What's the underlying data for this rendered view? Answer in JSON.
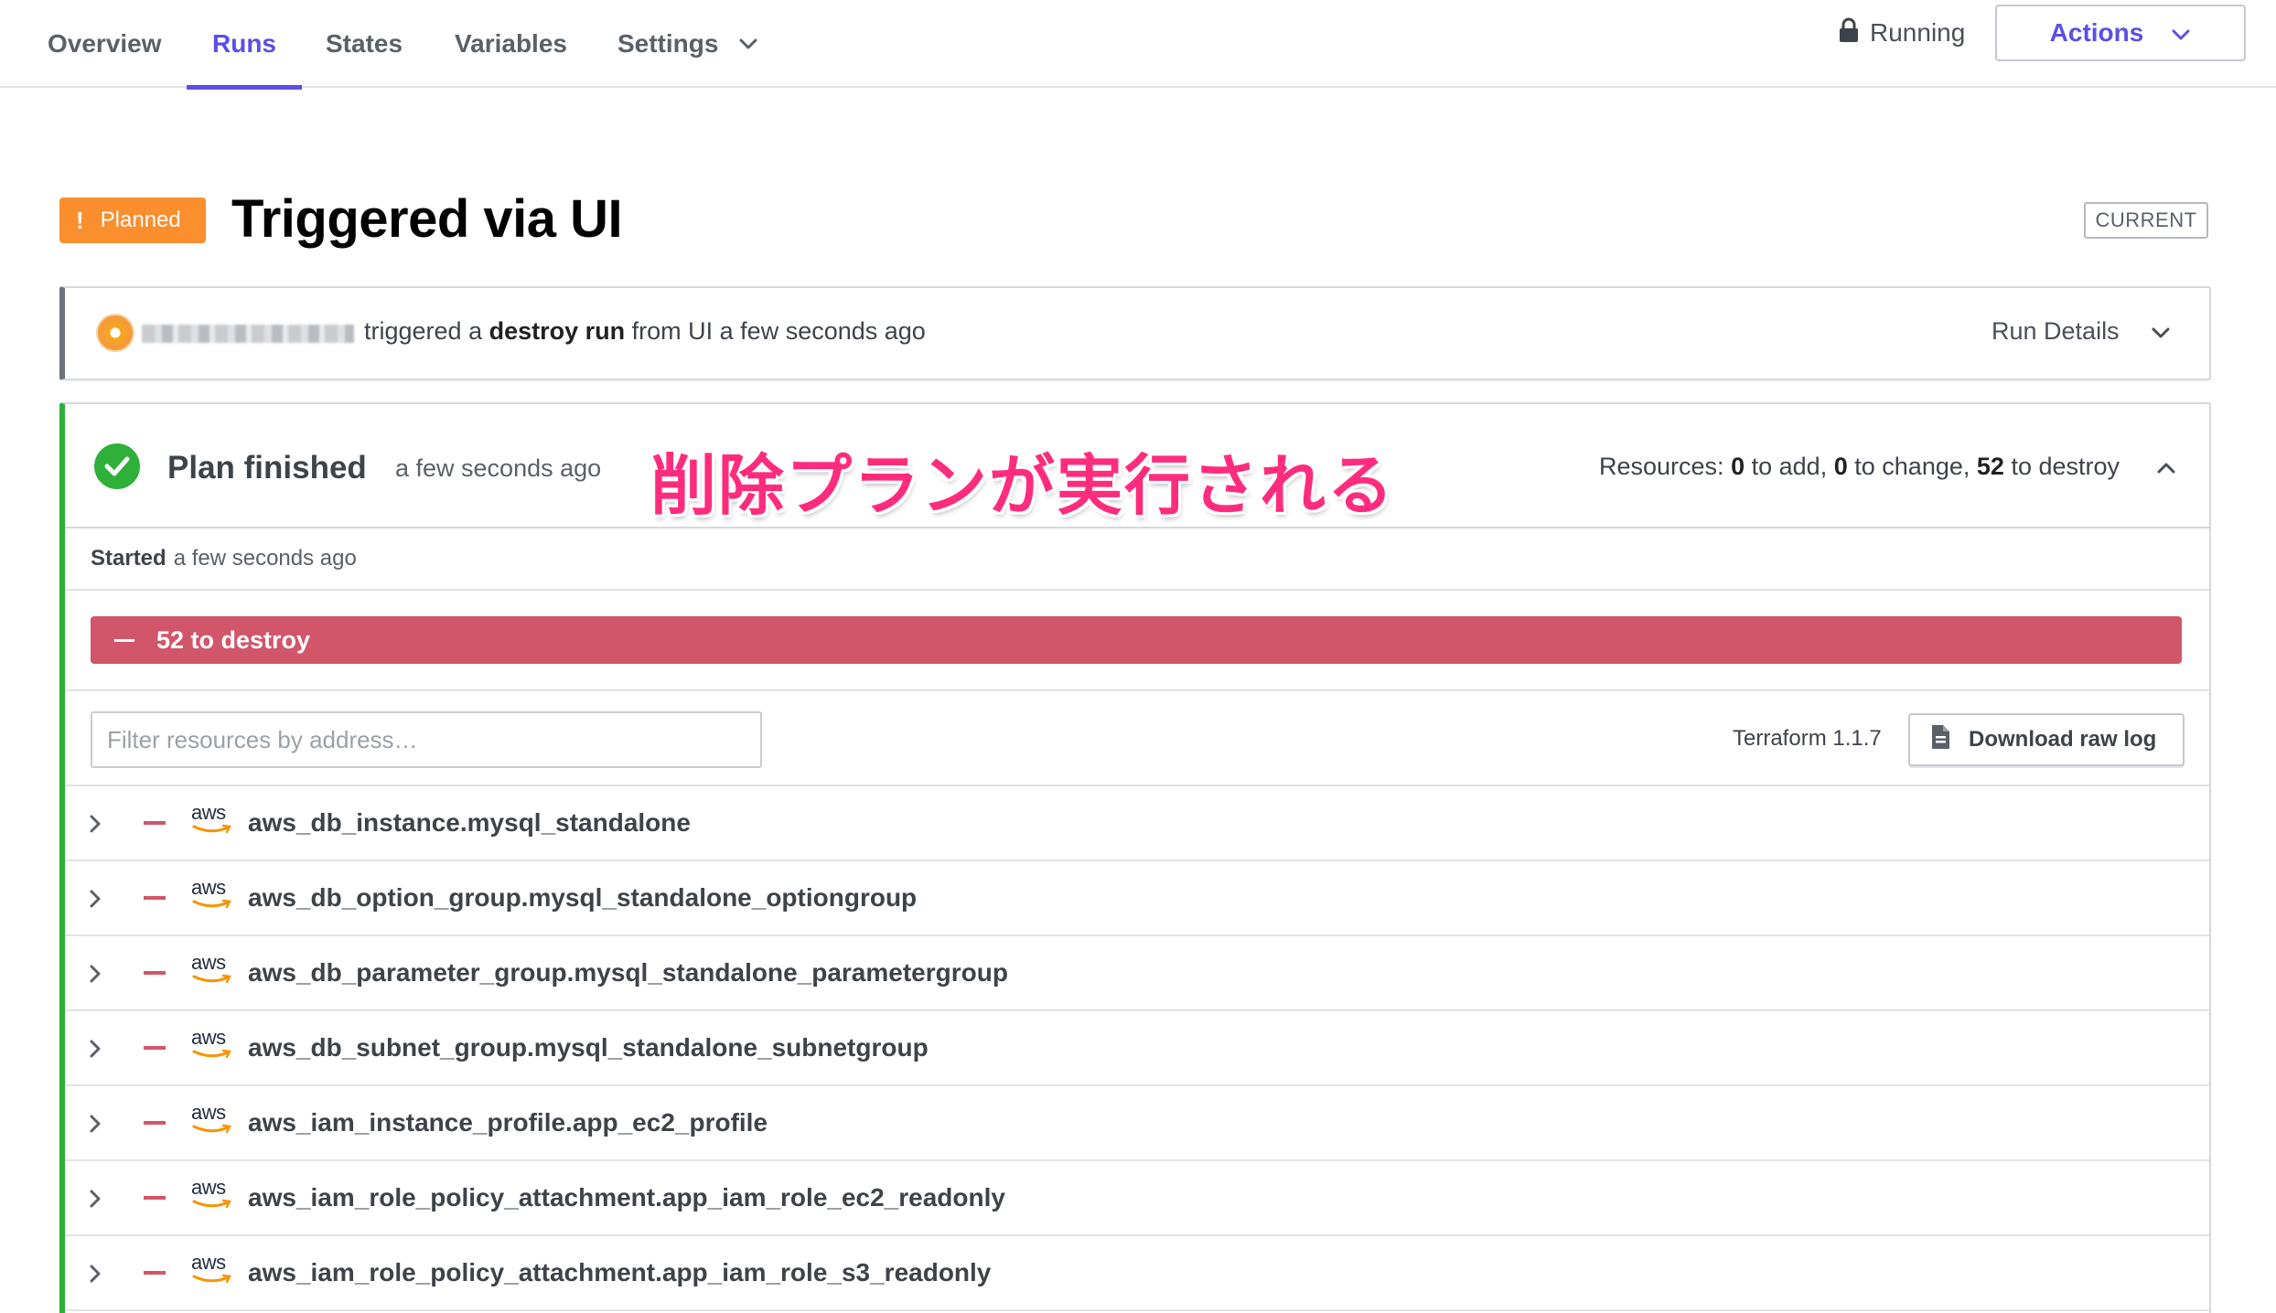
{
  "nav": {
    "tabs": [
      {
        "label": "Overview"
      },
      {
        "label": "Runs"
      },
      {
        "label": "States"
      },
      {
        "label": "Variables"
      },
      {
        "label": "Settings"
      }
    ],
    "active_tab": "Runs",
    "lock_status": "Running",
    "actions_label": "Actions"
  },
  "run": {
    "status_badge": "Planned",
    "status_badge_icon": "!",
    "title": "Triggered via UI",
    "current_label": "CURRENT",
    "trigger": {
      "before": "triggered a",
      "bold": "destroy run",
      "after": "from UI a few seconds ago"
    },
    "run_details_label": "Run Details"
  },
  "plan": {
    "title": "Plan finished",
    "time": "a few seconds ago",
    "annotation": "削除プランが実行される",
    "resources": {
      "label": "Resources:",
      "add": "0",
      "add_label": "to add,",
      "change": "0",
      "change_label": "to change,",
      "destroy": "52",
      "destroy_label": "to destroy"
    },
    "started_label": "Started",
    "started_time": "a few seconds ago",
    "destroy_bar_label": "52 to destroy",
    "filter_placeholder": "Filter resources by address…",
    "terraform_version": "Terraform 1.1.7",
    "download_label": "Download raw log",
    "provider_logo_text": "aws",
    "resources_list": [
      "aws_db_instance.mysql_standalone",
      "aws_db_option_group.mysql_standalone_optiongroup",
      "aws_db_parameter_group.mysql_standalone_parametergroup",
      "aws_db_subnet_group.mysql_standalone_subnetgroup",
      "aws_iam_instance_profile.app_ec2_profile",
      "aws_iam_role_policy_attachment.app_iam_role_ec2_readonly",
      "aws_iam_role_policy_attachment.app_iam_role_s3_readonly"
    ]
  },
  "colors": {
    "accent": "#5c4ee5",
    "planned": "#fb8e2d",
    "success": "#2eb039",
    "destroy": "#d1566a",
    "annotation": "#ff2c7d"
  }
}
